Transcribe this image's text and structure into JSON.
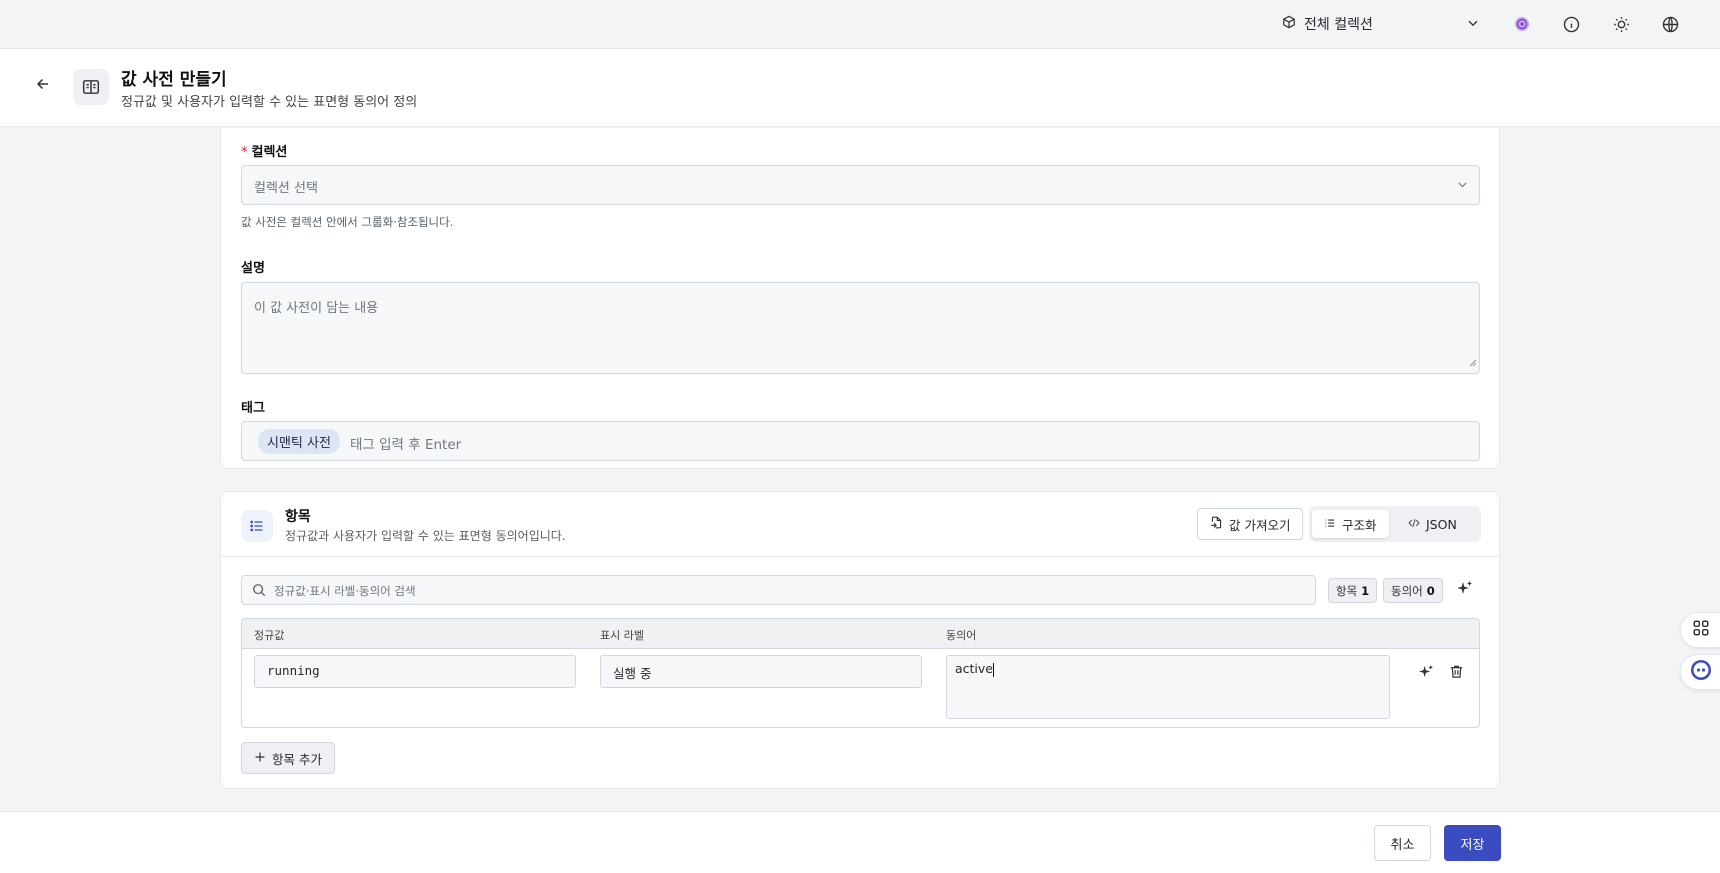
{
  "topbar": {
    "collection_label": "전체 컬렉션"
  },
  "header": {
    "title": "값 사전 만들기",
    "subtitle": "정규값 및 사용자가 입력할 수 있는 표면형 동의어 정의"
  },
  "form": {
    "collection_label": "컬렉션",
    "collection_placeholder": "컬렉션 선택",
    "collection_hint": "값 사전은 컬렉션 안에서 그룹화·참조됩니다.",
    "description_label": "설명",
    "description_placeholder": "이 값 사전이 담는 내용",
    "tags_label": "태그",
    "tags": [
      "시맨틱 사전"
    ],
    "tags_placeholder": "태그 입력 후 Enter"
  },
  "items_section": {
    "title": "항목",
    "subtitle": "정규값과 사용자가 입력할 수 있는 표면형 동의어입니다.",
    "import_label": "값 가져오기",
    "view_structured": "구조화",
    "view_json": "JSON",
    "search_placeholder": "정규값·표시 라벨·동의어 검색",
    "count_items_label": "항목",
    "count_items": "1",
    "count_synonyms_label": "동의어",
    "count_synonyms": "0",
    "columns": [
      "정규값",
      "표시 라벨",
      "동의어"
    ],
    "rows": [
      {
        "canonical": "running",
        "label": "실행 중",
        "synonyms": "active"
      }
    ],
    "add_label": "항목 추가"
  },
  "footer": {
    "cancel_label": "취소",
    "save_label": "저장"
  },
  "colors": {
    "primary": "#3b4cc0",
    "required": "#d1242f",
    "tag_bg": "#dde4f4"
  },
  "icons": [
    "cube-icon",
    "chevron-down-icon",
    "assistant-icon",
    "info-icon",
    "sun-icon",
    "globe-icon",
    "arrow-left-icon",
    "book-open-icon",
    "list-icon",
    "import-icon",
    "code-icon",
    "search-icon",
    "sparkle-icon",
    "trash-icon",
    "plus-icon",
    "apps-icon",
    "bot-icon"
  ]
}
